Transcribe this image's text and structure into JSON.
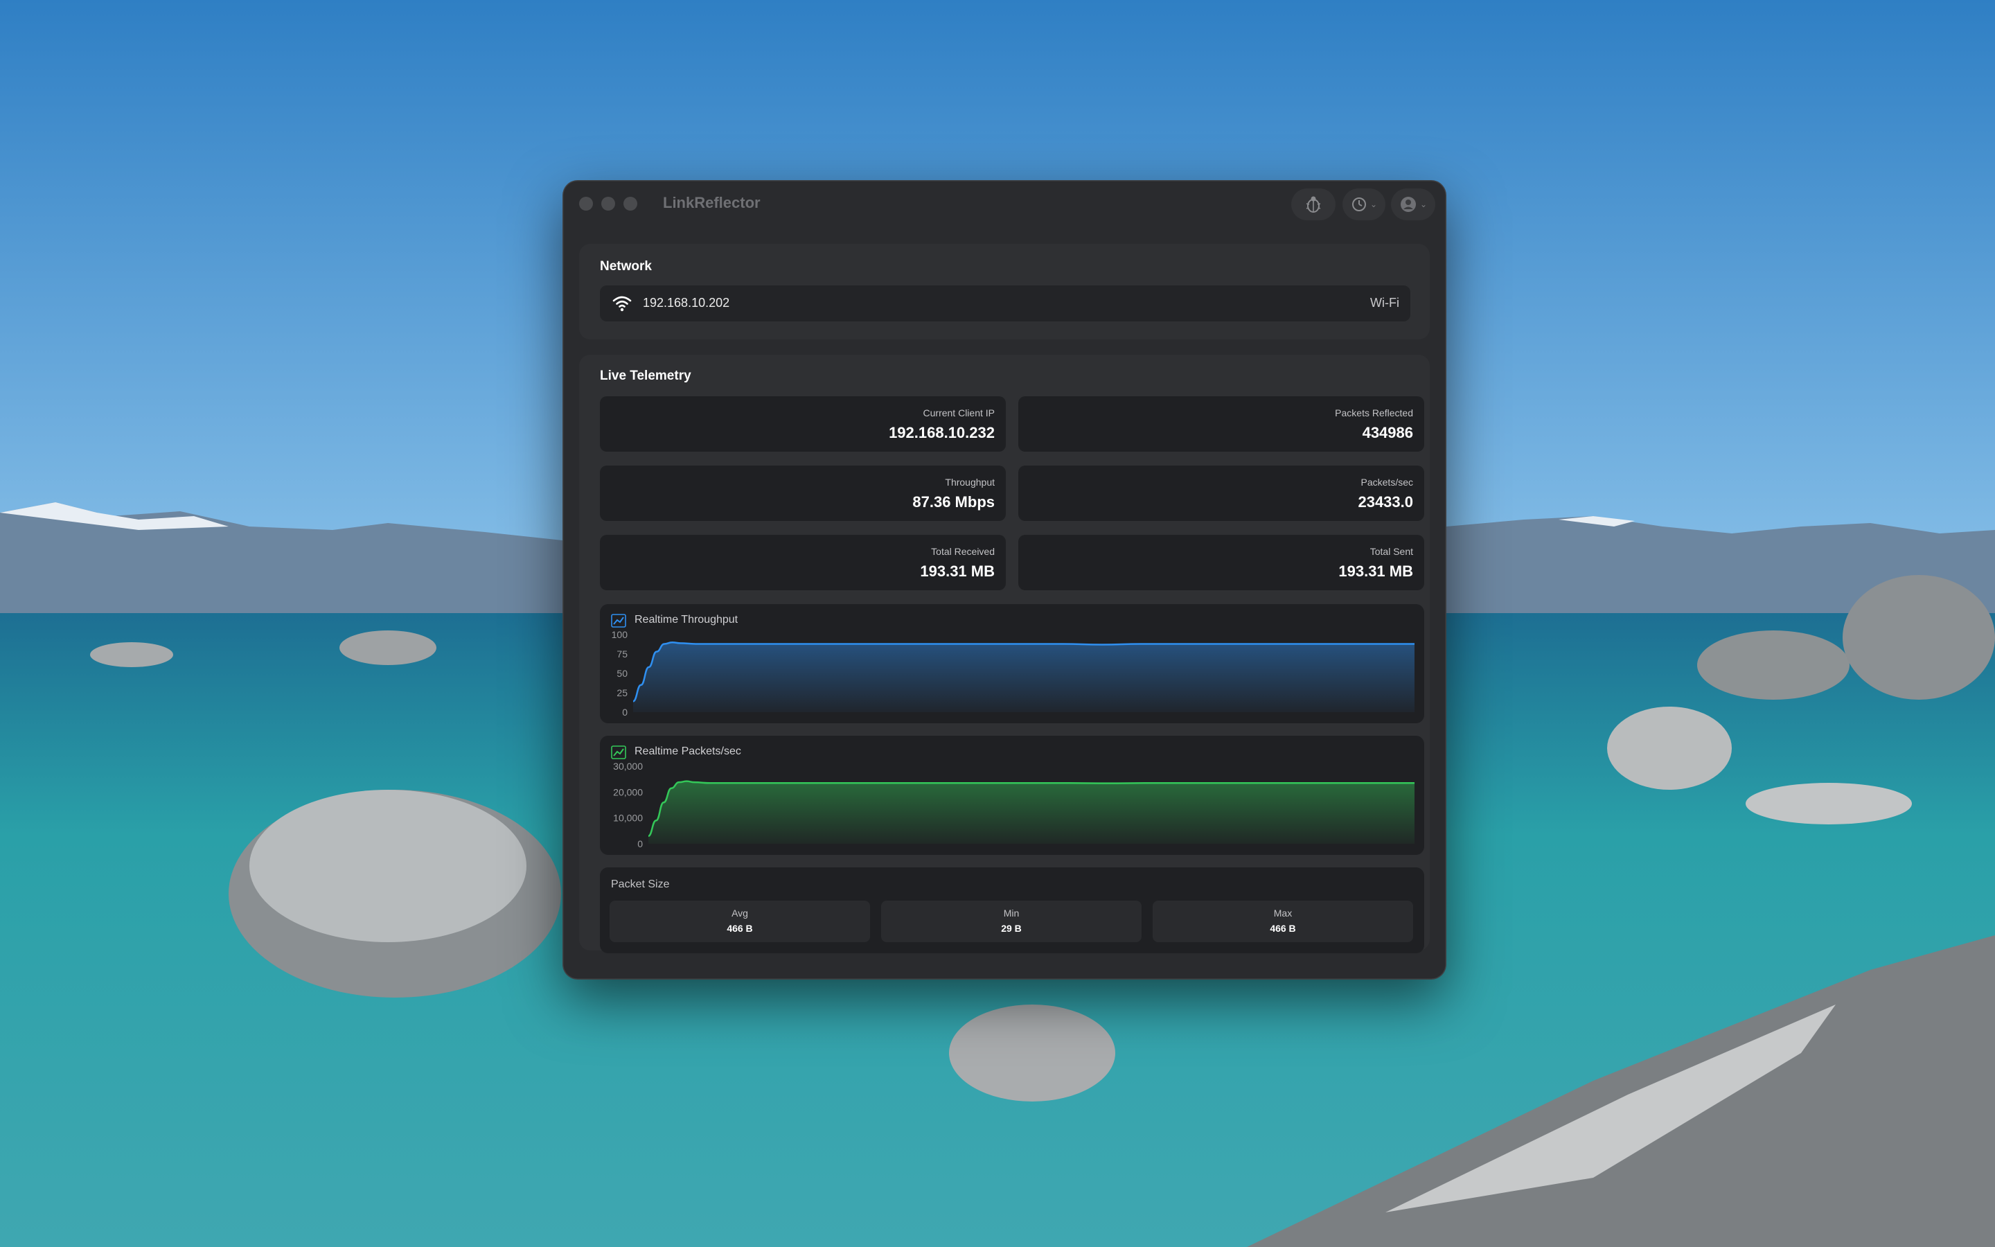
{
  "window": {
    "title": "LinkReflector"
  },
  "toolbar": {
    "debug_icon": "ladybug-icon",
    "timer_icon": "timer-icon",
    "account_icon": "avatar-icon"
  },
  "network": {
    "title": "Network",
    "ip": "192.168.10.202",
    "type": "Wi-Fi",
    "icon": "wifi-icon"
  },
  "telemetry": {
    "title": "Live Telemetry",
    "stats": {
      "client_ip": {
        "label": "Current Client IP",
        "value": "192.168.10.232"
      },
      "packets_reflected": {
        "label": "Packets Reflected",
        "value": "434986"
      },
      "throughput": {
        "label": "Throughput",
        "value": "87.36 Mbps"
      },
      "packets_sec": {
        "label": "Packets/sec",
        "value": "23433.0"
      },
      "total_received": {
        "label": "Total Received",
        "value": "193.31 MB"
      },
      "total_sent": {
        "label": "Total Sent",
        "value": "193.31 MB"
      }
    }
  },
  "colors": {
    "throughput_line": "#2f8ff0",
    "packets_line": "#34c759",
    "window_bg": "#2a2b2e"
  },
  "chart_data": [
    {
      "type": "area",
      "title": "Realtime Throughput",
      "y_ticks": [
        "100",
        "75",
        "50",
        "25",
        "0"
      ],
      "ylim": [
        0,
        100
      ],
      "x": [
        0,
        1,
        2,
        3,
        4,
        5,
        6,
        8,
        10,
        15,
        20,
        25,
        30,
        35,
        40,
        45,
        50,
        55,
        60,
        65,
        70,
        75,
        80,
        85,
        90,
        95,
        100
      ],
      "values": [
        14,
        35,
        58,
        78,
        88,
        90,
        89,
        88,
        88,
        88,
        88,
        88,
        88,
        88,
        88,
        88,
        88,
        88,
        87,
        88,
        88,
        88,
        88,
        88,
        88,
        88,
        88
      ]
    },
    {
      "type": "area",
      "title": "Realtime Packets/sec",
      "y_ticks": [
        "30,000",
        "20,000",
        "10,000",
        "0"
      ],
      "ylim": [
        0,
        30000
      ],
      "x": [
        0,
        1,
        2,
        3,
        4,
        5,
        6,
        8,
        10,
        15,
        20,
        25,
        30,
        35,
        40,
        45,
        50,
        55,
        60,
        65,
        70,
        75,
        80,
        85,
        90,
        95,
        100
      ],
      "values": [
        3000,
        9000,
        16000,
        21500,
        23800,
        24200,
        23800,
        23500,
        23500,
        23500,
        23500,
        23500,
        23500,
        23500,
        23500,
        23500,
        23500,
        23500,
        23400,
        23500,
        23500,
        23500,
        23500,
        23500,
        23500,
        23500,
        23500
      ]
    }
  ],
  "packet_size": {
    "title": "Packet Size",
    "avg": {
      "label": "Avg",
      "value": "466 B"
    },
    "min": {
      "label": "Min",
      "value": "29 B"
    },
    "max": {
      "label": "Max",
      "value": "466 B"
    }
  }
}
